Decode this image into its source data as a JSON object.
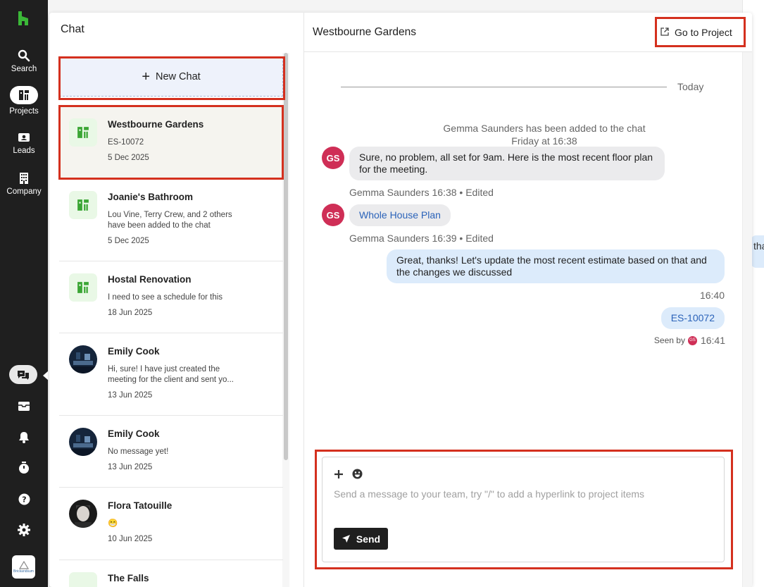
{
  "rail": {
    "items": [
      {
        "label": "Search",
        "icon": "search-icon"
      },
      {
        "label": "Projects",
        "icon": "projects-icon"
      },
      {
        "label": "Leads",
        "icon": "leads-icon"
      },
      {
        "label": "Company",
        "icon": "company-icon"
      }
    ],
    "bottom_icons": [
      "chat-icon",
      "inbox-icon",
      "bell-icon",
      "timer-icon",
      "help-icon",
      "settings-icon"
    ],
    "avatar_text": "Brickandsum"
  },
  "chat_panel": {
    "title": "Chat",
    "new_chat_label": "New Chat",
    "conversations": [
      {
        "name": "Westbourne Gardens",
        "preview": "ES-10072",
        "date": "5 Dec 2025",
        "kind": "project",
        "active": true
      },
      {
        "name": "Joanie's Bathroom",
        "preview": "Lou Vine, Terry Crew, and 2 others have been added to the chat",
        "date": "5 Dec 2025",
        "kind": "project"
      },
      {
        "name": "Hostal Renovation",
        "preview": "I need to see a schedule for this",
        "date": "18 Jun 2025",
        "kind": "project"
      },
      {
        "name": "Emily Cook",
        "preview": "Hi, sure! I have just created the meeting for the client and sent yo...",
        "date": "13 Jun 2025",
        "kind": "person"
      },
      {
        "name": "Emily Cook",
        "preview": "No message yet!",
        "date": "13 Jun 2025",
        "kind": "person"
      },
      {
        "name": "Flora Tatouille",
        "preview": "😁",
        "date": "10 Jun 2025",
        "kind": "person"
      },
      {
        "name": "The Falls",
        "preview": "",
        "date": "",
        "kind": "project"
      }
    ]
  },
  "conversation": {
    "title": "Westbourne Gardens",
    "go_to_project_label": "Go to Project",
    "divider_label": "Today",
    "system_message": "Gemma Saunders has been added to the chat",
    "system_time": "Friday at 16:38",
    "messages": [
      {
        "avatar": "GS",
        "text": "Sure, no problem, all set for 9am. Here is the most recent floor plan for the meeting.",
        "meta": "Gemma Saunders 16:38 • Edited"
      },
      {
        "avatar": "GS",
        "text": "Whole House Plan",
        "meta": "Gemma Saunders 16:39 • Edited"
      },
      {
        "text": "Great, thanks! Let's update the most recent estimate based on that and the changes we discussed",
        "time": "16:40"
      },
      {
        "text": "ES-10072"
      }
    ],
    "seen_label": "Seen by",
    "seen_avatar": "GS",
    "seen_time": "16:41"
  },
  "composer": {
    "placeholder": "Send a message to your team, try \"/\" to add a hyperlink to project items",
    "send_label": "Send"
  },
  "background": {
    "peek_text": "tha e c"
  },
  "colors": {
    "rail_bg": "#1f1f1f",
    "accent_green": "#2e9c2a",
    "highlight_red": "#d4301e",
    "avatar_gs": "#cf2e56",
    "bubble_out": "#dcebfb",
    "bubble_in": "#ebebed",
    "link": "#2b63b9"
  }
}
